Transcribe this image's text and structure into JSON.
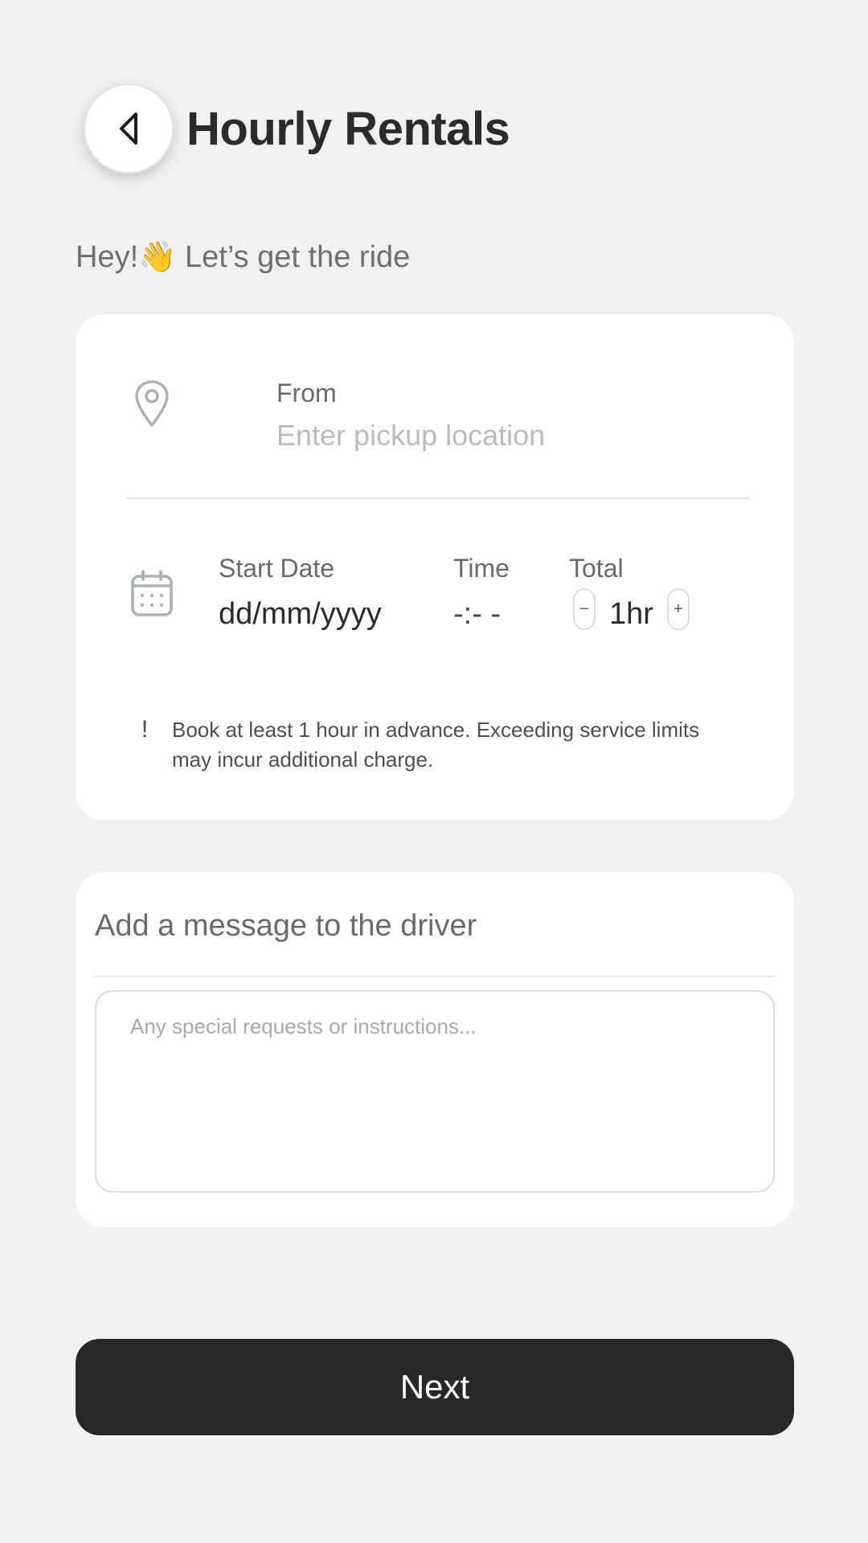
{
  "header": {
    "back_icon": "chevron-left-icon",
    "title": "Hourly Rentals"
  },
  "greeting": {
    "text": "Hey!👋 Let’s get the ride"
  },
  "trip": {
    "from_icon": "location-pin-icon",
    "from_label": "From",
    "from_placeholder": "Enter pickup location",
    "date_icon": "calendar-icon",
    "start_date_label": "Start Date",
    "start_date_value": "dd/mm/yyyy",
    "time_label": "Time",
    "time_value": "-:- -",
    "total_label": "Total",
    "total_minus": "−",
    "total_value": "1hr",
    "total_plus": "+",
    "notice_icon": "!",
    "notice_text": "Book at least 1 hour in advance. Exceeding service limits may incur additional charge."
  },
  "message": {
    "title": "Add a message to the driver",
    "placeholder": "Any special requests or instructions..."
  },
  "footer": {
    "next_label": "Next"
  },
  "colors": {
    "background": "#f1f1f1",
    "card": "#ffffff",
    "primary_button": "#282828",
    "icon": "#a8b3b0"
  }
}
